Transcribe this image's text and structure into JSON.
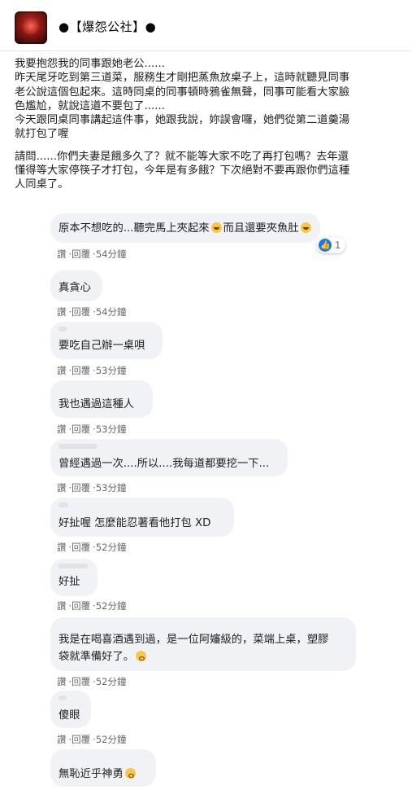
{
  "group": {
    "name": "●【爆怨公社】●"
  },
  "post": {
    "lines": [
      "我要抱怨我的同事跟她老公......",
      "昨天尾牙吃到第三道菜，服務生才剛把蒸魚放桌子上，這時就聽見同事",
      "老公說這個包起來。這時同桌的同事頓時鴉雀無聲，同事可能看大家臉",
      "色尷尬，就說這道不要包了......",
      "今天跟同桌同事講起這件事，她跟我說，妳誤會囉，她們從第二道羹湯",
      "就打包了喔"
    ],
    "lines2": [
      "請問......你們夫妻是餓多久了？就不能等大家不吃了再打包嗎？去年還",
      "懂得等大家停筷子才打包，今年是有多餓？下次絕對不要再跟你們這種",
      "人同桌了。"
    ]
  },
  "comment_actions": {
    "like": "讚",
    "reply": "回覆"
  },
  "comments": [
    {
      "text_a": "原本不想吃的...聽完馬上夾起來",
      "text_b": "而且還要夾魚肚",
      "time": "54分鐘",
      "reactions": "1"
    },
    {
      "text": "真貪心",
      "time": "54分鐘"
    },
    {
      "text": "要吃自己辦一桌唄",
      "time": "53分鐘"
    },
    {
      "text": "我也遇過這種人",
      "time": "53分鐘"
    },
    {
      "text": "曾經遇過一次....所以....我每道都要挖一下...",
      "time": "53分鐘"
    },
    {
      "text": "好扯喔 怎麼能忍著看他打包 XD",
      "time": "52分鐘"
    },
    {
      "text": "好扯",
      "time": "52分鐘"
    },
    {
      "text": "我是在喝喜酒遇到過，是一位阿嬸級的，菜端上桌，塑膠袋就準備好了。",
      "time": "52分鐘"
    },
    {
      "text": "傻眼",
      "time": "52分鐘"
    },
    {
      "text": "無恥近乎神勇"
    }
  ]
}
